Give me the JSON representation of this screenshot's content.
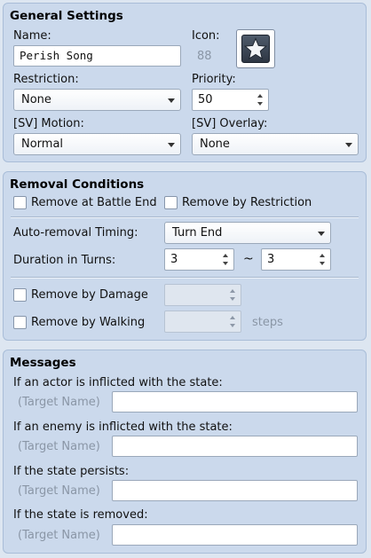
{
  "general": {
    "title": "General Settings",
    "name_label": "Name:",
    "name_value": "Perish Song",
    "icon_label": "Icon:",
    "icon_index": "88",
    "icon_name": "star-icon",
    "restriction_label": "Restriction:",
    "restriction_value": "None",
    "priority_label": "Priority:",
    "priority_value": "50",
    "motion_label": "[SV] Motion:",
    "motion_value": "Normal",
    "overlay_label": "[SV] Overlay:",
    "overlay_value": "None"
  },
  "removal": {
    "title": "Removal Conditions",
    "battle_end_label": "Remove at Battle End",
    "restriction_label": "Remove by Restriction",
    "timing_label": "Auto-removal Timing:",
    "timing_value": "Turn End",
    "duration_label": "Duration in Turns:",
    "duration_min": "3",
    "tilde": "~",
    "duration_max": "3",
    "damage_label": "Remove by Damage",
    "walking_label": "Remove by Walking",
    "steps_label": "steps"
  },
  "messages": {
    "title": "Messages",
    "items": [
      {
        "label": "If an actor is inflicted with the state:",
        "prefix": "(Target Name)",
        "value": ""
      },
      {
        "label": "If an enemy is inflicted with the state:",
        "prefix": "(Target Name)",
        "value": ""
      },
      {
        "label": "If the state persists:",
        "prefix": "(Target Name)",
        "value": ""
      },
      {
        "label": "If the state is removed:",
        "prefix": "(Target Name)",
        "value": ""
      }
    ]
  },
  "colors": {
    "background": "#dde6f1",
    "panel": "#cbd9ec",
    "border": "#a9bdd8"
  }
}
